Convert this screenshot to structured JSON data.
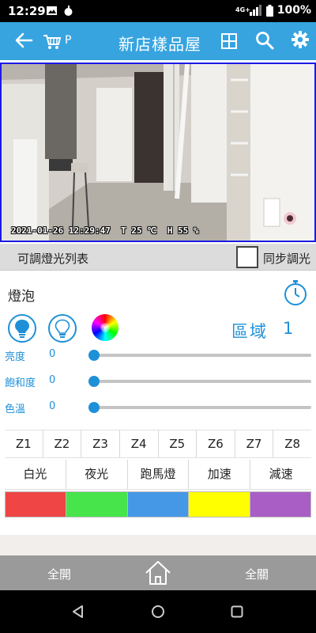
{
  "status_bar": {
    "time": "12:29",
    "battery": "100%"
  },
  "app_bar": {
    "title": "新店樣品屋",
    "p_label": "P",
    "icons": [
      "back-arrow-icon",
      "cart-icon",
      "grid-icon",
      "search-icon",
      "gear-icon"
    ]
  },
  "camera": {
    "timestamp": "2021-01-26 12:29:47",
    "temperature": "T 25 ℃",
    "humidity": "H 55 %"
  },
  "list_bar": {
    "title": "可調燈光列表",
    "sync_label": "同步調光",
    "sync_checked": false
  },
  "bulb": {
    "label": "燈泡",
    "zone_label": "區域",
    "zone_number": "1"
  },
  "sliders": [
    {
      "label": "亮度",
      "value": "0",
      "fraction": 0
    },
    {
      "label": "飽和度",
      "value": "0",
      "fraction": 0
    },
    {
      "label": "色溫",
      "value": "0",
      "fraction": 0
    }
  ],
  "zones": [
    "Z1",
    "Z2",
    "Z3",
    "Z4",
    "Z5",
    "Z6",
    "Z7",
    "Z8"
  ],
  "effects": [
    "白光",
    "夜光",
    "跑馬燈",
    "加速",
    "減速"
  ],
  "swatches": [
    "#ef4545",
    "#47e44b",
    "#4598e6",
    "#ffff00",
    "#a95ec6"
  ],
  "action_bar": {
    "all_on": "全開",
    "all_off": "全關"
  },
  "colors": {
    "app_bar": "#37a4e0",
    "accent": "#1e90d8",
    "action_bar": "#9a9a9a"
  }
}
